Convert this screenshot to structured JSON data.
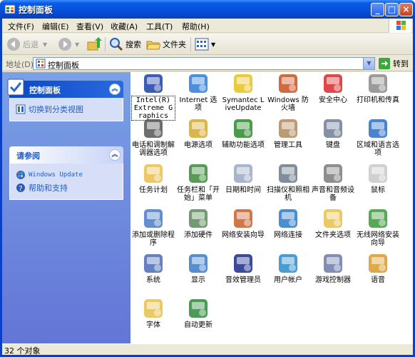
{
  "window": {
    "title": "控制面板"
  },
  "menu": [
    "文件(F)",
    "编辑(E)",
    "查看(V)",
    "收藏(A)",
    "工具(T)",
    "帮助(H)"
  ],
  "toolbar": {
    "back": "后退",
    "search": "搜索",
    "folders": "文件夹"
  },
  "address": {
    "label": "地址(D)",
    "value": "控制面板",
    "go": "转到"
  },
  "sidebar": {
    "panel1": {
      "title": "控制面板",
      "link": "切换到分类视图"
    },
    "panel2": {
      "title": "请参阅",
      "links": [
        "Windows Update",
        "帮助和支持"
      ]
    }
  },
  "items": [
    {
      "name": "Intel(R) Extreme Graphics",
      "icon": "intel-graphics-icon",
      "color": "#1c3fa8"
    },
    {
      "name": "Internet 选项",
      "icon": "internet-options-icon",
      "color": "#2e7bd6"
    },
    {
      "name": "Symantec LiveUpdate",
      "icon": "symantec-liveupdate-icon",
      "color": "#e8c21c"
    },
    {
      "name": "Windows 防火墙",
      "icon": "firewall-icon",
      "color": "#c8501e"
    },
    {
      "name": "安全中心",
      "icon": "security-center-icon",
      "color": "#d8282a"
    },
    {
      "name": "打印机和传真",
      "icon": "printer-icon",
      "color": "#8a8a8a"
    },
    {
      "name": "电话和调制解调器选项",
      "icon": "phone-modem-icon",
      "color": "#555555"
    },
    {
      "name": "电源选项",
      "icon": "power-options-icon",
      "color": "#d4a82c"
    },
    {
      "name": "辅助功能选项",
      "icon": "accessibility-icon",
      "color": "#2a8a2a"
    },
    {
      "name": "管理工具",
      "icon": "admin-tools-icon",
      "color": "#b0885a"
    },
    {
      "name": "键盘",
      "icon": "keyboard-icon",
      "color": "#6f7d96"
    },
    {
      "name": "区域和语言选项",
      "icon": "regional-icon",
      "color": "#2a6ec8"
    },
    {
      "name": "任务计划",
      "icon": "scheduled-tasks-icon",
      "color": "#e8c04a"
    },
    {
      "name": "任务栏和「开始」菜单",
      "icon": "taskbar-icon",
      "color": "#3a8a3a"
    },
    {
      "name": "日期和时间",
      "icon": "date-time-icon",
      "color": "#9aa8c4"
    },
    {
      "name": "扫描仪和照相机",
      "icon": "scanner-icon",
      "color": "#6a7a8a"
    },
    {
      "name": "声音和音频设备",
      "icon": "sound-icon",
      "color": "#7a7a7a"
    },
    {
      "name": "鼠标",
      "icon": "mouse-icon",
      "color": "#c8c8c8"
    },
    {
      "name": "添加或删除程序",
      "icon": "add-remove-icon",
      "color": "#4a7ac8"
    },
    {
      "name": "添加硬件",
      "icon": "add-hardware-icon",
      "color": "#5a8a5a"
    },
    {
      "name": "网络安装向导",
      "icon": "network-wizard-icon",
      "color": "#c8602a"
    },
    {
      "name": "网络连接",
      "icon": "network-connections-icon",
      "color": "#2a7ac8"
    },
    {
      "name": "文件夹选项",
      "icon": "folder-options-icon",
      "color": "#e8c04a"
    },
    {
      "name": "无线网络安装向导",
      "icon": "wireless-icon",
      "color": "#3a9a3a"
    },
    {
      "name": "系统",
      "icon": "system-icon",
      "color": "#4a6ab8"
    },
    {
      "name": "显示",
      "icon": "display-icon",
      "color": "#3a7ac8"
    },
    {
      "name": "音效管理员",
      "icon": "sound-manager-icon",
      "color": "#1a2a8a"
    },
    {
      "name": "用户帐户",
      "icon": "user-accounts-icon",
      "color": "#2a8ac8"
    },
    {
      "name": "游戏控制器",
      "icon": "game-controller-icon",
      "color": "#6a7aa8"
    },
    {
      "name": "语音",
      "icon": "speech-icon",
      "color": "#d89a2a"
    },
    {
      "name": "字体",
      "icon": "fonts-icon",
      "color": "#e8c04a"
    },
    {
      "name": "自动更新",
      "icon": "auto-update-icon",
      "color": "#2a8a3a"
    }
  ],
  "status": {
    "text": "32 个对象"
  }
}
